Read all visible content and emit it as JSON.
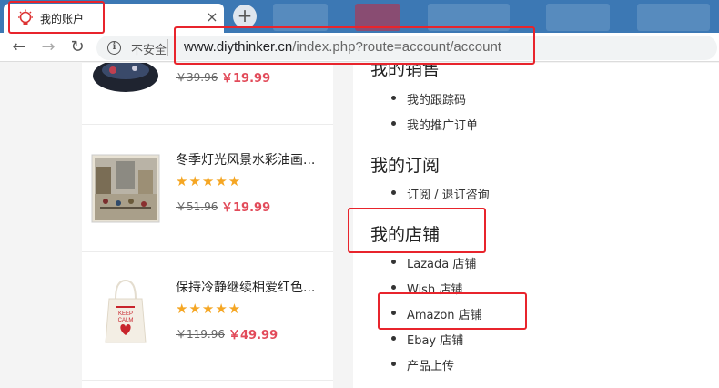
{
  "tab": {
    "title": "我的账户",
    "close": "×"
  },
  "new_tab_label": "+",
  "toolbar": {
    "back": "←",
    "forward": "→",
    "reload": "↻"
  },
  "omnibox": {
    "security_label": "不安全",
    "host": "www.diythinker.cn",
    "path": "/index.php?route=account/account"
  },
  "products": [
    {
      "name": "",
      "old_price": "￥39.96",
      "new_price": "￥19.99"
    },
    {
      "name": "冬季灯光风景水彩油画...",
      "stars": "★★★★★",
      "old_price": "￥51.96",
      "new_price": "￥19.99"
    },
    {
      "name": "保持冷静继续相爱红色...",
      "stars": "★★★★★",
      "old_price": "￥119.96",
      "new_price": "￥49.99"
    }
  ],
  "tote_text": {
    "line1": "KEEP",
    "line2": "CALM"
  },
  "account": {
    "sales": {
      "title": "我的销售",
      "links": [
        "我的跟踪码",
        "我的推广订单"
      ]
    },
    "subscription": {
      "title": "我的订阅",
      "links": [
        "订阅 / 退订咨询"
      ]
    },
    "stores": {
      "title": "我的店铺",
      "links": [
        "Lazada 店铺",
        "Wish 店铺",
        "Amazon 店铺",
        "Ebay 店铺",
        "产品上传"
      ]
    }
  },
  "colors": {
    "highlight": "#e8242c",
    "price": "#e24b5a",
    "star": "#f5a623",
    "tabstrip": "#3c78b4"
  }
}
